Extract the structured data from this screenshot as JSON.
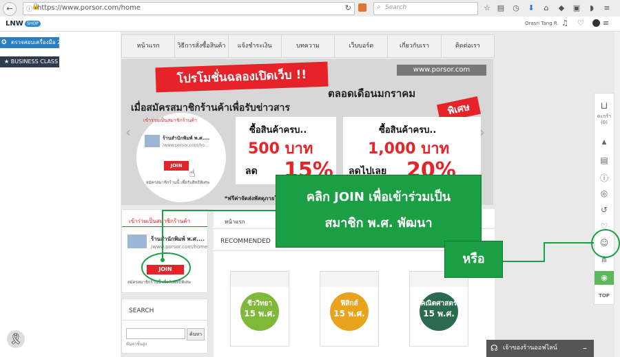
{
  "browser": {
    "url": "https://www.porsor.com/home",
    "search_placeholder": "Search"
  },
  "site_topbar": {
    "logo_text": "LNW",
    "logo_badge": "SHOP",
    "user_name": "Orasri Tang R."
  },
  "left_ribbons": {
    "ribbon1": "ตรวจสอบเครื่องมือ 2",
    "ribbon2": "★ BUSINESS CLASS ★"
  },
  "menu": [
    "หน้าแรก",
    "วิธีการสั่งซื้อสินค้า",
    "แจ้งชำระเงิน",
    "บทความ",
    "เว็บบอร์ด",
    "เกี่ยวกับเรา",
    "ติดต่อเรา"
  ],
  "banner": {
    "headline": "โปรโมชั่นฉลองเปิดเว็บ !!",
    "site_label": "www.porsor.com",
    "subline": "ตลอดเดือนมกราคม",
    "condition": "เมื่อสมัครสมาชิกร้านค้าเพื่อรับข่าวสาร",
    "special": "พิเศษ",
    "member_card_title": "เข้าร่วมเป็นสมาชิกร้านค้า",
    "member_shop_name": "ร้านสำนักพิมพ์ พ.ศ....",
    "member_shop_url": "/www.porsor.com/ho...",
    "join_label": "JOIN",
    "member_note": "สมัครสมาชิกร้านนี้ เพื่อรับสิทธิพิเศษ",
    "deal1_top": "ซื้อสินค้าครบ..",
    "deal1_amount": "500 บาท",
    "deal1_discount_label": "ลด",
    "deal1_discount": "15%",
    "deal2_top": "ซื้อสินค้าครบ..",
    "deal2_amount": "1,000 บาท",
    "deal2_discount_label": "ลดไปเลย",
    "deal2_discount": "20%",
    "footnote": "*ฟรีค่าจัดส่งพัสดุภายในประ"
  },
  "sidebar": {
    "member_title": "เข้าร่วมเป็นสมาชิกร้านค้า",
    "shop_name": "ร้านสำนักพิมพ์ พ.ศ....",
    "shop_url": "/www.porsor.com/home",
    "join_label": "JOIN",
    "note": "สมัครสมาชิกร้านนี้ เพื่อรับสิทธิพิเศษ",
    "search_title": "SEARCH",
    "search_button": "ค้นหา",
    "advanced_search": "ค้นหาขั้นสูง"
  },
  "content": {
    "breadcrumb": "หน้าแรก",
    "section_title": "RECOMMENDED",
    "products": [
      {
        "subject": "ชีววิทยา",
        "grade": "15 พ.ศ."
      },
      {
        "subject": "ฟิสิกส์",
        "grade": "15 พ.ศ."
      },
      {
        "subject": "คณิตศาสตร์",
        "grade": "15 พ.ศ."
      }
    ]
  },
  "callouts": {
    "main_line1": "คลิก JOIN เพื่อเข้าร่วมเป็น",
    "main_line2": "สมาชิก พ.ศ. พัฒนา",
    "or": "หรือ"
  },
  "right_toolbar": {
    "cart_label": "ตะกร้า",
    "cart_count": "(0)",
    "top_label": "TOP"
  },
  "chat": {
    "label": "เจ้าของร้านออฟไลน์"
  },
  "colors": {
    "accent_green": "#1a9f44",
    "brand_red": "#e52329",
    "ribbon_blue": "#2b7fc1",
    "ribbon_dark": "#2d3b4d"
  }
}
